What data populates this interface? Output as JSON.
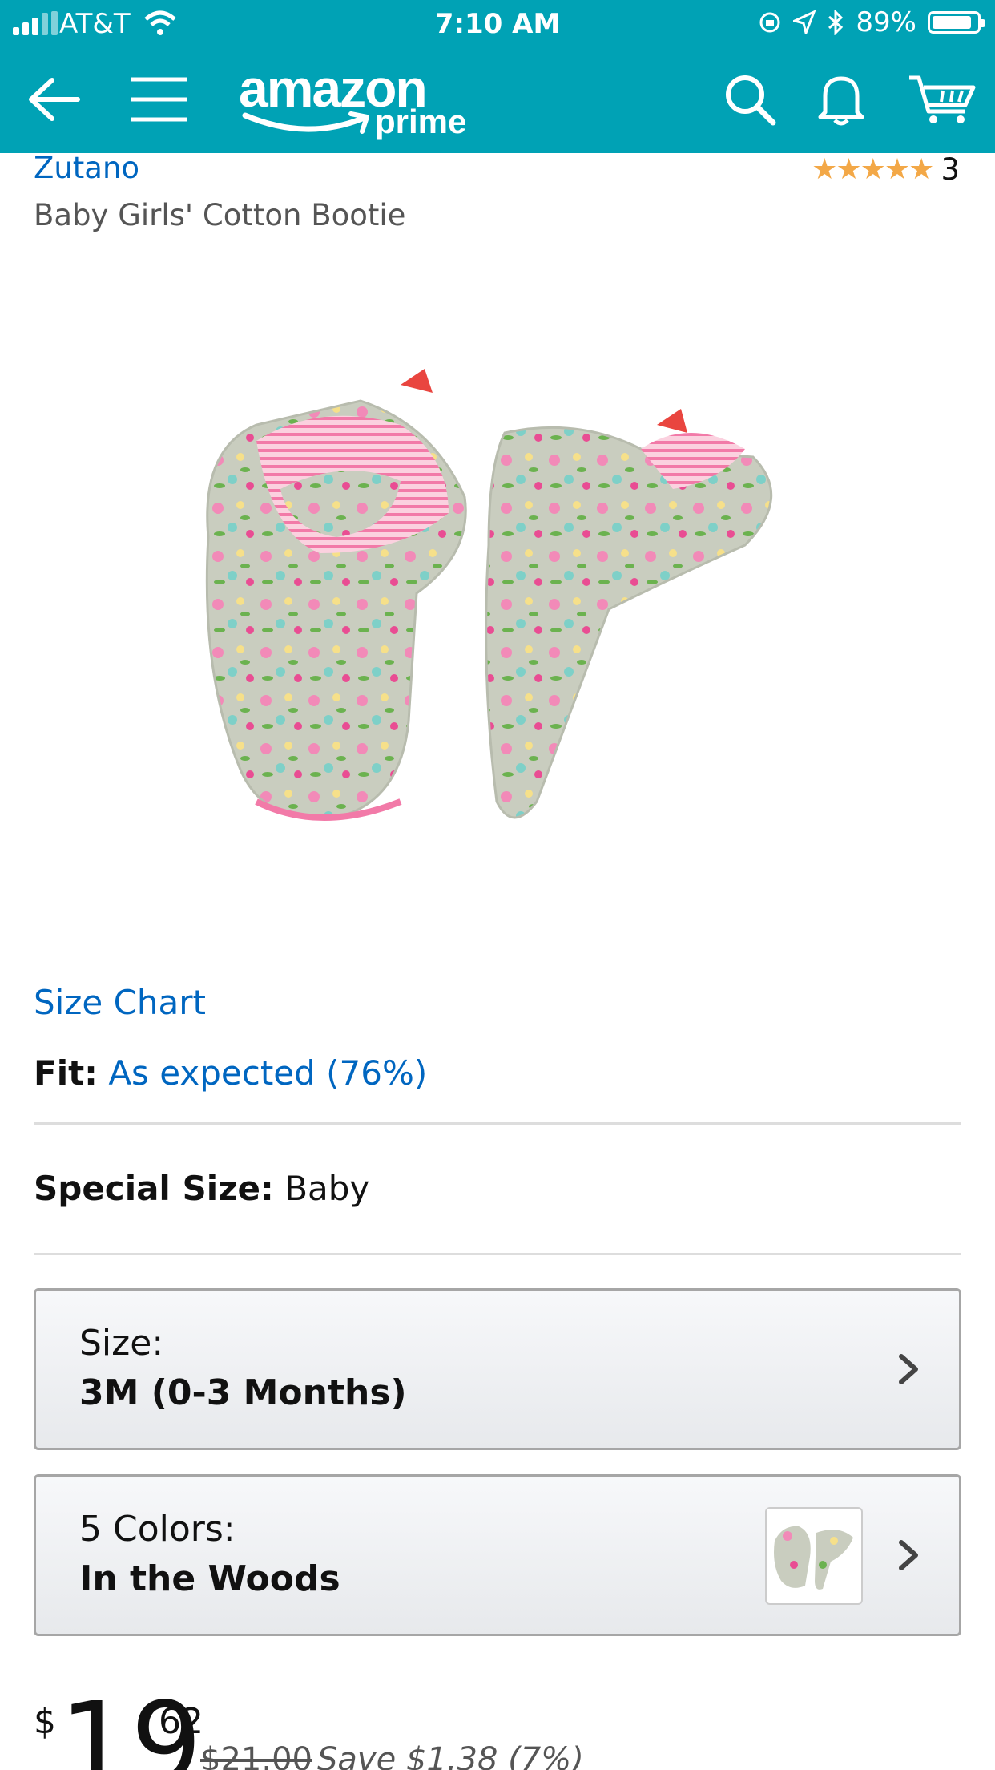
{
  "status_bar": {
    "carrier": "AT&T",
    "time": "7:10 AM",
    "battery_percent": "89%",
    "battery_level": 0.89
  },
  "nav": {
    "logo_word": "amazon",
    "logo_sub": "prime",
    "icons": [
      "back-arrow-icon",
      "menu-icon",
      "search-icon",
      "bell-icon",
      "cart-icon"
    ]
  },
  "product": {
    "brand": "Zutano",
    "title": "Baby Girls' Cotton Bootie",
    "rating_stars": "★★★★★",
    "rating_count": "3",
    "size_chart_label": "Size Chart",
    "fit_label": "Fit:",
    "fit_value": "As expected (76%)",
    "special_size_label": "Special Size:",
    "special_size_value": "Baby"
  },
  "options": {
    "size": {
      "label": "Size:",
      "value": "3M (0-3 Months)"
    },
    "colors": {
      "label": "5 Colors:",
      "value": "In the Woods"
    }
  },
  "price": {
    "currency": "$",
    "whole": "19",
    "fraction": "62",
    "list_price": "$21.00",
    "savings": "Save $1.38 (7%)"
  },
  "colors": {
    "header_bg": "#00a2b5",
    "link": "#0066c0",
    "star": "#f3a847"
  }
}
